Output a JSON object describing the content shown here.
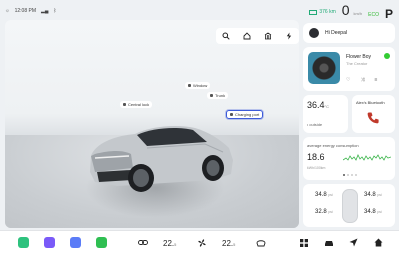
{
  "status": {
    "time": "12:08 PM",
    "range": "376 km",
    "speed": "0",
    "speed_unit": "km/h",
    "mode": "ECO",
    "gear": "P"
  },
  "scene_labels": {
    "window": "Window",
    "trunk": "Trunk",
    "central_lock": "Central lock",
    "charging_port": "Charging port"
  },
  "profile": {
    "greeting": "Hi Deepal"
  },
  "music": {
    "song": "Flower Boy",
    "artist": "The Creator"
  },
  "climate": {
    "temp": "36.4",
    "unit": "°C",
    "label": "outside"
  },
  "bluetooth": {
    "device": "Alex's Bluetooth"
  },
  "energy": {
    "title": "average energy consumption",
    "value": "18.6",
    "unit": "kWh/100km"
  },
  "tires": {
    "fl": "34.8",
    "fr": "34.8",
    "rl": "32.8",
    "rr": "34.8",
    "unit": "psi"
  },
  "dock": {
    "temp_left": "22.",
    "temp_left_dec": "5",
    "temp_right": "22.",
    "temp_right_dec": "5"
  },
  "colors": {
    "accent": "#3d5bd9",
    "green": "#33cc33"
  }
}
